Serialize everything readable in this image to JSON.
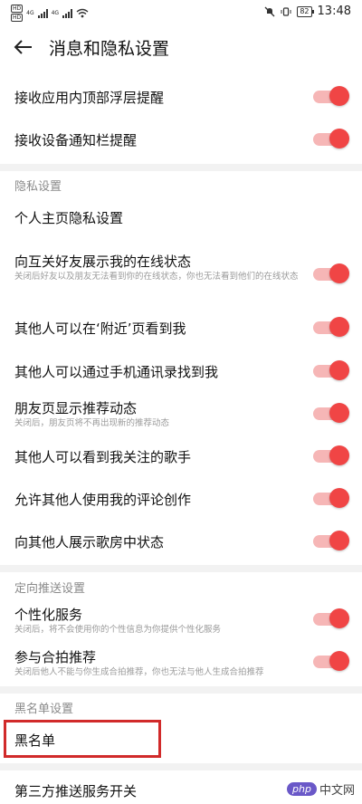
{
  "status": {
    "left_tags": [
      "HD",
      "HD"
    ],
    "net_labels": [
      "4G",
      "4G"
    ],
    "battery": "82",
    "time": "13:48"
  },
  "header": {
    "title": "消息和隐私设置"
  },
  "top_settings": [
    {
      "label": "接收应用内顶部浮层提醒",
      "on": true
    },
    {
      "label": "接收设备通知栏提醒",
      "on": true
    }
  ],
  "privacy": {
    "section_title": "隐私设置",
    "profile_privacy": "个人主页隐私设置",
    "items": [
      {
        "label": "向互关好友展示我的在线状态",
        "sub": "关闭后好友以及朋友无法看到你的在线状态，你也无法看到他们的在线状态",
        "on": true
      },
      {
        "label": "其他人可以在‘附近’页看到我",
        "on": true
      },
      {
        "label": "其他人可以通过手机通讯录找到我",
        "on": true
      },
      {
        "label": "朋友页显示推荐动态",
        "sub": "关闭后，朋友页将不再出现新的推荐动态",
        "on": true
      },
      {
        "label": "其他人可以看到我关注的歌手",
        "on": true
      },
      {
        "label": "允许其他人使用我的评论创作",
        "on": true
      },
      {
        "label": "向其他人展示歌房中状态",
        "on": true
      }
    ]
  },
  "push": {
    "section_title": "定向推送设置",
    "items": [
      {
        "label": "个性化服务",
        "sub": "关闭后，将不会使用你的个性信息为你提供个性化服务",
        "on": true
      },
      {
        "label": "参与合拍推荐",
        "sub": "关闭后他人不能与你生成合拍推荐，你也无法与他人生成合拍推荐",
        "on": true
      }
    ]
  },
  "blacklist": {
    "section_title": "黑名单设置",
    "item": "黑名单"
  },
  "third_party": {
    "label": "第三方推送服务开关"
  },
  "watermark": {
    "logo": "php",
    "text": "中文网"
  }
}
